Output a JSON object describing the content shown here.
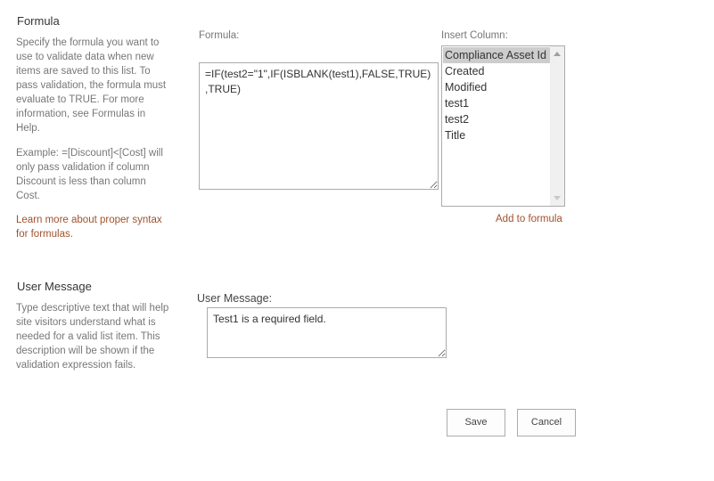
{
  "formula_section": {
    "title": "Formula",
    "description": "Specify the formula you want to use to validate data when new items are saved to this list. To pass validation, the formula must evaluate to TRUE. For more information, see Formulas in Help.",
    "example": "Example: =[Discount]<[Cost] will only pass validation if column Discount is less than column Cost.",
    "learn_more_link": "Learn more about proper syntax for formulas.",
    "formula_label": "Formula:",
    "formula_value": "=IF(test2=\"1\",IF(ISBLANK(test1),FALSE,TRUE),TRUE)",
    "insert_column_label": "Insert Column:",
    "columns": [
      "Compliance Asset Id",
      "Created",
      "Modified",
      "test1",
      "test2",
      "Title"
    ],
    "selected_column": "Compliance Asset Id",
    "add_to_formula_link": "Add to formula"
  },
  "user_message_section": {
    "title": "User Message",
    "description": "Type descriptive text that will help site visitors understand what is needed for a valid list item. This description will be shown if the validation expression fails.",
    "field_label": "User Message:",
    "field_value": "Test1 is a required field."
  },
  "buttons": {
    "save_label": "Save",
    "cancel_label": "Cancel"
  },
  "colors": {
    "link": "#a0522d",
    "selected_item_bg": "#cdcdcd",
    "border": "#ababab"
  }
}
